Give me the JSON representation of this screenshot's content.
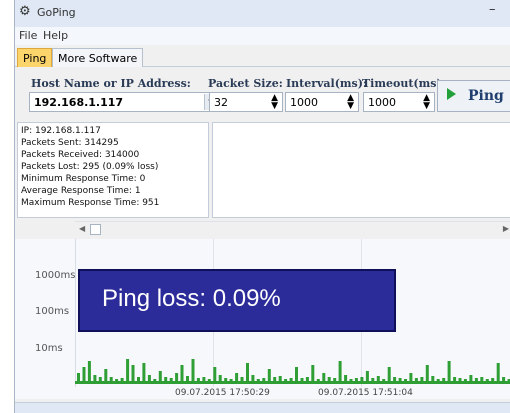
{
  "window": {
    "title": "GoPing",
    "minimize_glyph": "–"
  },
  "menu": {
    "items": [
      "File",
      "Help"
    ]
  },
  "tabs": [
    {
      "label": "Ping",
      "active": true
    },
    {
      "label": "More Software",
      "active": false
    }
  ],
  "controls": {
    "host_label": "Host Name or IP Address:",
    "host_value": "192.168.1.117",
    "packet_size_label": "Packet Size:",
    "packet_size_value": "32",
    "interval_label": "Interval(ms):",
    "interval_value": "1000",
    "timeout_label": "Timeout(ms):",
    "timeout_value": "1000",
    "ping_button": "Ping"
  },
  "stats": {
    "lines": [
      "IP: 192.168.1.117",
      "Packets Sent: 314295",
      "Packets Received: 314000",
      "Packets Lost: 295 (0.09% loss)",
      "Minimum Response Time: 0",
      "Average Response Time: 1",
      "Maximum Response Time: 951"
    ]
  },
  "chart": {
    "y_labels": [
      "1000ms",
      "100ms",
      "10ms"
    ],
    "x_labels": [
      "09.07.2015 17:50:29",
      "09.07.2015 17:51:04"
    ],
    "bar_color": "#2f9e35"
  },
  "overlay": {
    "text": "Ping loss: 0.09%"
  },
  "colors": {
    "active_tab": "#fbd56b",
    "overlay_bg": "#2c2b9a",
    "play": "#24a03b"
  }
}
